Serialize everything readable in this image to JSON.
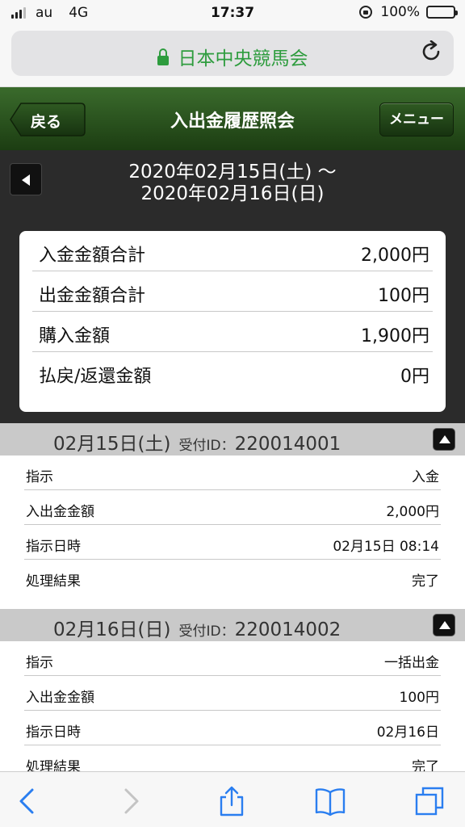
{
  "status_bar": {
    "carrier": "au",
    "network": "4G",
    "time": "17:37",
    "battery": "100%"
  },
  "browser": {
    "url_title": "日本中央競馬会"
  },
  "header": {
    "back_label": "戻る",
    "title": "入出金履歴照会",
    "menu_label": "メニュー"
  },
  "date_range": {
    "from": "2020年02月15日(土) 〜",
    "to": "2020年02月16日(日)"
  },
  "summary": [
    {
      "label": "入金金額合計",
      "value": "2,000円"
    },
    {
      "label": "出金金額合計",
      "value": "100円"
    },
    {
      "label": "購入金額",
      "value": "1,900円"
    },
    {
      "label": "払戻/返還金額",
      "value": "0円"
    }
  ],
  "transactions": [
    {
      "date": "02月15日(土)",
      "id_label": "受付ID：",
      "id": "220014001",
      "rows": [
        {
          "label": "指示",
          "value": "入金"
        },
        {
          "label": "入出金金額",
          "value": "2,000円"
        },
        {
          "label": "指示日時",
          "value": "02月15日 08:14"
        },
        {
          "label": "処理結果",
          "value": "完了"
        }
      ]
    },
    {
      "date": "02月16日(日)",
      "id_label": "受付ID：",
      "id": "220014002",
      "rows": [
        {
          "label": "指示",
          "value": "一括出金"
        },
        {
          "label": "入出金金額",
          "value": "100円"
        },
        {
          "label": "指示日時",
          "value": "02月16日"
        },
        {
          "label": "処理結果",
          "value": "完了"
        }
      ]
    }
  ],
  "toolbar": {
    "icons": [
      "back-icon",
      "forward-icon",
      "share-icon",
      "bookmarks-icon",
      "tabs-icon"
    ]
  },
  "colors": {
    "header_green": "#2d5a20",
    "url_green": "#2e9c3e",
    "safari_blue": "#2a7ef0",
    "dark_bg": "#2b2b2b"
  }
}
